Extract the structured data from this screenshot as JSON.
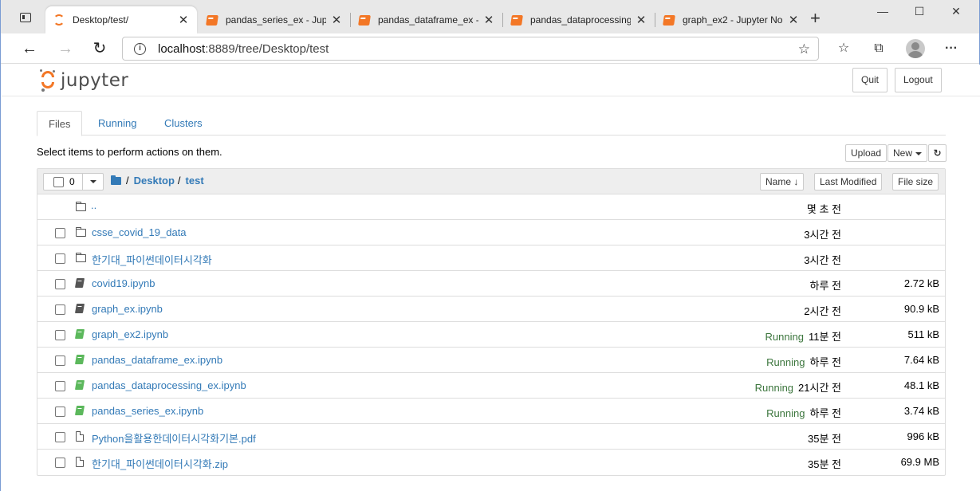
{
  "browser": {
    "tabs": [
      {
        "title": "Desktop/test/",
        "favicon": "jupyter-icon",
        "active": true
      },
      {
        "title": "pandas_series_ex - Jupy",
        "favicon": "notebook-icon",
        "active": false
      },
      {
        "title": "pandas_dataframe_ex -",
        "favicon": "notebook-icon",
        "active": false
      },
      {
        "title": "pandas_dataprocessing",
        "favicon": "notebook-icon",
        "active": false
      },
      {
        "title": "graph_ex2 - Jupyter No",
        "favicon": "notebook-icon",
        "active": false
      }
    ],
    "close_glyph": "✕",
    "new_tab_glyph": "+",
    "minimize_glyph": "—",
    "maximize_glyph": "☐",
    "window_close_glyph": "✕",
    "address": {
      "host": "localhost",
      "rest": ":8889/tree/Desktop/test"
    },
    "nav": {
      "back": "←",
      "forward": "→",
      "reload": "↻",
      "info": "i"
    },
    "toolbar_glyphs": {
      "favorites_add": "☆",
      "favorites": "☆",
      "collections": "⧉",
      "menu": "···"
    },
    "accent": "#f37726"
  },
  "jupyter": {
    "logo_text": "jupyter",
    "quit_label": "Quit",
    "logout_label": "Logout",
    "tabs": [
      "Files",
      "Running",
      "Clusters"
    ],
    "hint": "Select items to perform actions on them.",
    "upload_label": "Upload",
    "new_label": "New",
    "refresh_glyph": "↻",
    "selected_count": "0",
    "breadcrumb": {
      "root": "/",
      "parts": [
        "Desktop",
        "test"
      ]
    },
    "sort": {
      "name": "Name ↓",
      "last_modified": "Last Modified",
      "file_size": "File size"
    },
    "updir": {
      "name": "..",
      "modified": "몇 초 전"
    },
    "files": [
      {
        "name": "csse_covid_19_data",
        "type": "folder",
        "status": "",
        "modified": "3시간 전",
        "size": ""
      },
      {
        "name": "한기대_파이썬데이터시각화",
        "type": "folder",
        "status": "",
        "modified": "3시간 전",
        "size": ""
      },
      {
        "name": "covid19.ipynb",
        "type": "notebook",
        "status": "",
        "modified": "하루 전",
        "size": "2.72 kB"
      },
      {
        "name": "graph_ex.ipynb",
        "type": "notebook",
        "status": "",
        "modified": "2시간 전",
        "size": "90.9 kB"
      },
      {
        "name": "graph_ex2.ipynb",
        "type": "notebook-running",
        "status": "Running",
        "modified": "11분 전",
        "size": "511 kB"
      },
      {
        "name": "pandas_dataframe_ex.ipynb",
        "type": "notebook-running",
        "status": "Running",
        "modified": "하루 전",
        "size": "7.64 kB"
      },
      {
        "name": "pandas_dataprocessing_ex.ipynb",
        "type": "notebook-running",
        "status": "Running",
        "modified": "21시간 전",
        "size": "48.1 kB"
      },
      {
        "name": "pandas_series_ex.ipynb",
        "type": "notebook-running",
        "status": "Running",
        "modified": "하루 전",
        "size": "3.74 kB"
      },
      {
        "name": "Python을활용한데이터시각화기본.pdf",
        "type": "file",
        "status": "",
        "modified": "35분 전",
        "size": "996 kB"
      },
      {
        "name": "한기대_파이썬데이터시각화.zip",
        "type": "file",
        "status": "",
        "modified": "35분 전",
        "size": "69.9 MB"
      }
    ],
    "colors": {
      "link": "#337ab7",
      "running": "#3c763d",
      "notebook_running": "#5cb85c"
    }
  }
}
